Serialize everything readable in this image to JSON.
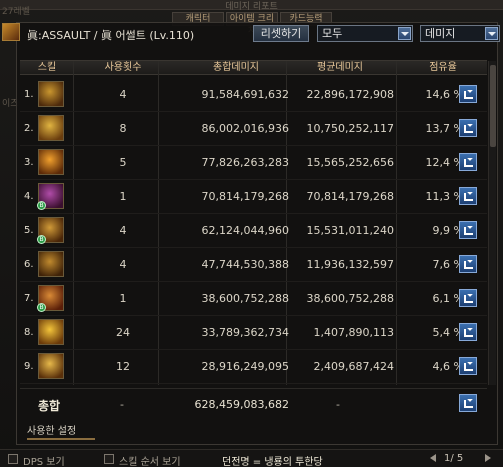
{
  "header": {
    "title": "眞:ASSAULT / 眞 어썰트 (Lv.110)",
    "reset_label": "리셋하기",
    "mode_select": "모두",
    "metric_select": "데미지"
  },
  "columns": {
    "skill": "스킬",
    "uses": "사용횟수",
    "total": "총합데미지",
    "avg": "평균데미지",
    "share": "점유율"
  },
  "rows": [
    {
      "rank": "1.",
      "uses": "4",
      "total": "91,584,691,632",
      "avg": "22,896,172,908",
      "share": "14,6 %",
      "badge": false,
      "color1": "#c9962f",
      "color2": "#4d2a0c"
    },
    {
      "rank": "2.",
      "uses": "8",
      "total": "86,002,016,936",
      "avg": "10,750,252,117",
      "share": "13,7 %",
      "badge": false,
      "color1": "#e0b441",
      "color2": "#6a3d0e"
    },
    {
      "rank": "3.",
      "uses": "5",
      "total": "77,826,263,283",
      "avg": "15,565,252,656",
      "share": "12,4 %",
      "badge": false,
      "color1": "#f1a02d",
      "color2": "#5c2a08"
    },
    {
      "rank": "4.",
      "uses": "1",
      "total": "70,814,179,268",
      "avg": "70,814,179,268",
      "share": "11,3 %",
      "badge": true,
      "color1": "#b04ca8",
      "color2": "#3a0f2e"
    },
    {
      "rank": "5.",
      "uses": "4",
      "total": "62,124,044,960",
      "avg": "15,531,011,240",
      "share": "9,9 %",
      "badge": true,
      "color1": "#d09a38",
      "color2": "#4a2608"
    },
    {
      "rank": "6.",
      "uses": "4",
      "total": "47,744,530,388",
      "avg": "11,936,132,597",
      "share": "7,6 %",
      "badge": false,
      "color1": "#c08a2e",
      "color2": "#3f2208"
    },
    {
      "rank": "7.",
      "uses": "1",
      "total": "38,600,752,288",
      "avg": "38,600,752,288",
      "share": "6,1 %",
      "badge": true,
      "color1": "#d98a36",
      "color2": "#5a1e08"
    },
    {
      "rank": "8.",
      "uses": "24",
      "total": "33,789,362,734",
      "avg": "1,407,890,113",
      "share": "5,4 %",
      "badge": false,
      "color1": "#f3c43a",
      "color2": "#6b3a0a"
    },
    {
      "rank": "9.",
      "uses": "12",
      "total": "28,916,249,095",
      "avg": "2,409,687,424",
      "share": "4,6 %",
      "badge": false,
      "color1": "#e6b84a",
      "color2": "#5a300a"
    }
  ],
  "summary": {
    "label": "총합",
    "uses": "-",
    "total": "628,459,083,682",
    "avg": "-"
  },
  "settings_tab": "사용한 설정",
  "footer": {
    "dps_label": "DPS 보기",
    "order_label": "스킬 순서 보기",
    "dungeon": "던전명 = 냉룡의 투한당",
    "page": "1/ 5"
  },
  "background": {
    "title": "데미지 리포트",
    "tab1": "캐릭터",
    "tab2": "아이템 크리처",
    "tab3": "카드능력",
    "left1": "27레벨",
    "left2": "이즈"
  }
}
